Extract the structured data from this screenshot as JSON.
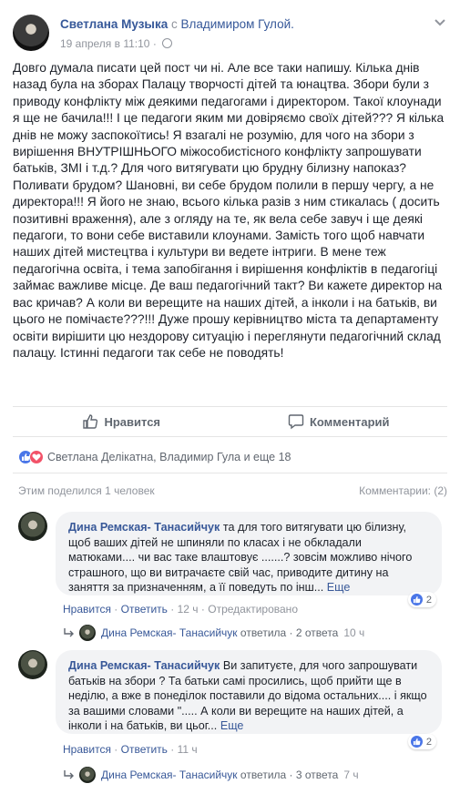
{
  "post": {
    "author": "Светлана Музыка",
    "with_word": "с",
    "coauthor": "Владимиром Гулой.",
    "timestamp": "19 апреля в 11:10",
    "separator": "·",
    "text": "Довго думала писати цей пост чи ні. Але все таки напишу. Кілька днів назад була на зборах Палацу творчості дітей та юнацтва. Збори були з приводу конфлікту між деякими педагогами і директором. Такої клоунади я ще не бачила!!! І це педагоги яким ми довіряємо своїх дітей??? Я кілька днів не можу заспокоїтись! Я взагалі не розумію, для чого на збори з вирішення ВНУТРІШНЬОГО міжособистісного конфлікту запрошувати батьків, ЗМІ і т.д.? Для чого витягувати цю брудну білизну напоказ? Поливати брудом? Шановні, ви себе брудом полили в першу чергу, а не директора!!! Я його не знаю, всього кілька разів з ним стикалась ( досить позитивні враження), але з огляду на те, як вела себе завуч і ще деякі педагоги, то вони себе виставили клоунами. Замість того щоб навчати наших дітей мистецтва і культури ви ведете інтриги. В мене теж педагогічна освіта, і тема запобігання і вирішення конфліктів в педагогіці займає важливе місце. Де ваш педагогічний такт? Ви кажете директор на вас кричав? А коли ви верещите на наших дітей, а інколи і на батьків, ви цього не помічаєте???!!! Дуже прошу керівництво міста та департаменту освіти вирішити цю нездорову ситуацію і переглянути педагогічний склад палацу. Істинні педагоги так себе не поводять!"
  },
  "actions": {
    "like_label": "Нравится",
    "comment_label": "Комментарий"
  },
  "summary": {
    "reactors": "Светлана Делікатна, Владимир Гула и еще 18",
    "shares": "Этим поделился 1 человек",
    "comments": "Комментарии: (2)"
  },
  "comments": [
    {
      "author": "Дина Ремская- Танасийчук",
      "text": "та для того витягувати цю білизну, щоб ваших дітей не шпиняли по класах і не обкладали матюками.... чи вас таке влаштовує .......? зовсім можливо нічого страшного, що ви витрачаєте свій час, приводите дитину на заняття за призначенням, а її поведуть по інш...",
      "more": "Еще",
      "reactions": "2",
      "like": "Нравится",
      "dot": "·",
      "reply": "Ответить",
      "time": "12 ч",
      "edited": "Отредактировано",
      "reply_summary": {
        "who": "Дина Ремская- Танасийчук",
        "verb": "ответила",
        "count": "2 ответа",
        "time": "10 ч"
      }
    },
    {
      "author": "Дина Ремская- Танасийчук",
      "text": "Ви запитуєте, для чого запрошувати батьків на збори ? Та батьки самі просились, щоб прийти ще в неділю, а вже в понеділок поставили до відома остальних.... і якщо за вашими словами \"..... А коли ви верещите на наших дітей, а інколи і на батьків, ви цьог...",
      "more": "Еще",
      "reactions": "2",
      "like": "Нравится",
      "dot": "·",
      "reply": "Ответить",
      "time": "11 ч",
      "reply_summary": {
        "who": "Дина Ремская- Танасийчук",
        "verb": "ответила",
        "count": "3 ответа",
        "time": "7 ч"
      }
    }
  ],
  "colors": {
    "link": "#365899",
    "muted": "#90949c",
    "like_blue": "#4a76e8",
    "love_red": "#f25268",
    "bubble": "#f2f3f5"
  },
  "icons": {
    "more": "chevron-down-icon",
    "privacy": "globe-icon",
    "like": "thumbs-up-icon",
    "comment": "speech-bubble-icon",
    "reply_arrow": "reply-arrow-icon"
  }
}
